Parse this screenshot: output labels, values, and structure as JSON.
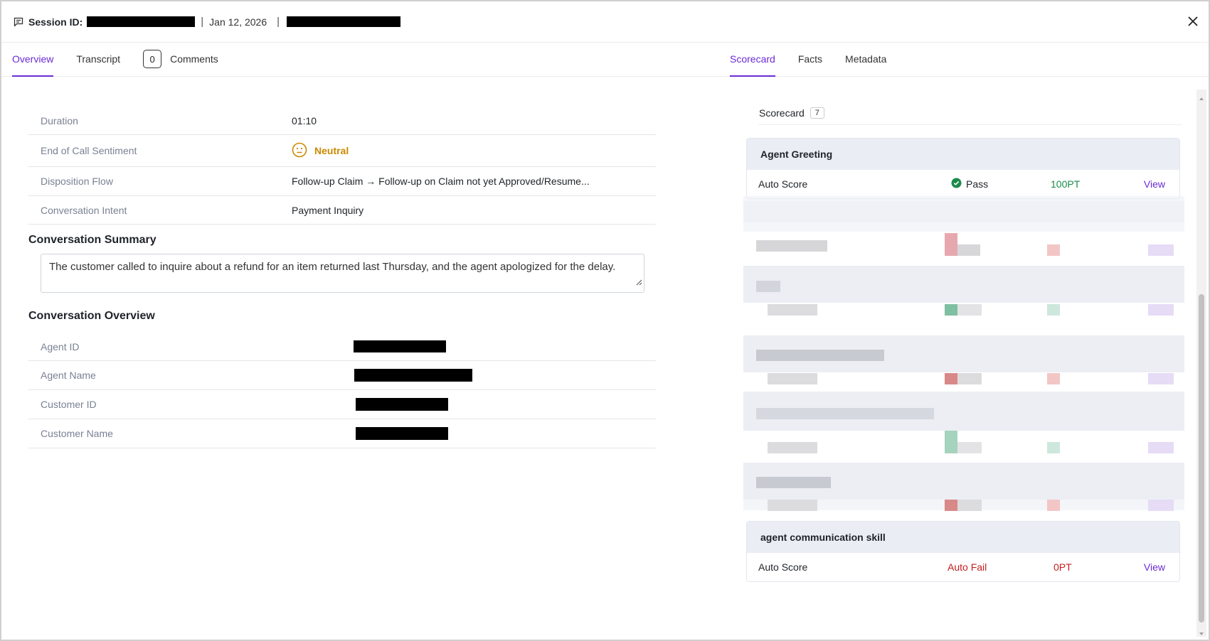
{
  "header": {
    "session_label": "Session ID:",
    "date": "Jan 12, 2026",
    "separator": "|"
  },
  "left_tabs": [
    {
      "label": "Overview",
      "active": true
    },
    {
      "label": "Transcript",
      "active": false
    },
    {
      "label": "Comments",
      "count": "0",
      "active": false
    }
  ],
  "right_tabs": [
    {
      "label": "Scorecard",
      "active": true
    },
    {
      "label": "Facts",
      "active": false
    },
    {
      "label": "Metadata",
      "active": false
    }
  ],
  "details": [
    {
      "label": "Duration",
      "value": "01:10"
    },
    {
      "label": "End of Call Sentiment",
      "value": "Neutral"
    },
    {
      "label": "Disposition Flow",
      "value": "Follow-up Claim → Follow-up on Claim not yet Approved/Resume..."
    },
    {
      "label": "Conversation Intent",
      "value": "Payment Inquiry"
    }
  ],
  "summary": {
    "title": "Conversation Summary",
    "text": "The customer called to inquire about a refund for an item returned last Thursday, and the agent apologized for the delay."
  },
  "overview": {
    "title": "Conversation Overview",
    "rows": [
      {
        "label": "Agent ID"
      },
      {
        "label": "Agent Name"
      },
      {
        "label": "Customer ID"
      },
      {
        "label": "Customer Name"
      }
    ]
  },
  "scorecard": {
    "title": "Scorecard",
    "count": "7",
    "cards": [
      {
        "title": "Agent Greeting",
        "row_label": "Auto Score",
        "status": "Pass",
        "points": "100PT",
        "view": "View"
      },
      {
        "title": "agent communication skill",
        "row_label": "Auto Score",
        "status": "Auto Fail",
        "points": "0PT",
        "view": "View"
      }
    ]
  },
  "colors": {
    "accent": "#6b2bd6",
    "pass_green": "#1a8a4a",
    "fail_red": "#c41e1e",
    "neutral_amber": "#c98a00"
  },
  "icons": [
    "chat-icon",
    "close-icon",
    "neutral-face-icon",
    "check-circle-icon",
    "resize-grip-icon"
  ]
}
